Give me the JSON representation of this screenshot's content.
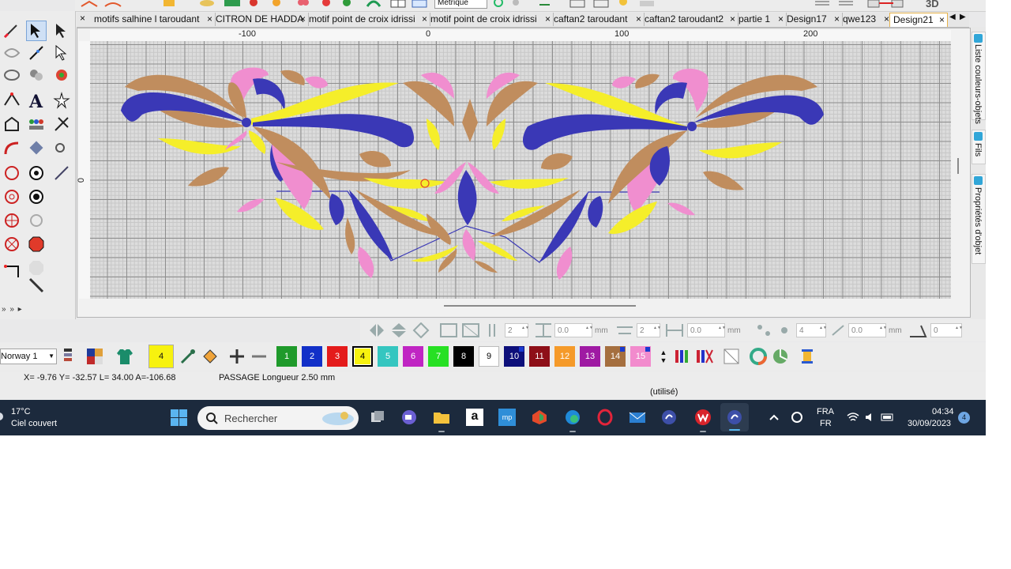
{
  "toolbar": {
    "unit_value": "Métrique",
    "top_right_text": "3D"
  },
  "tabs": [
    {
      "label": "motifs salhine l taroudant",
      "close": "×"
    },
    {
      "label": "CITRON DE HADDA",
      "close": "×"
    },
    {
      "label": "motif point de croix idrissi",
      "close": "×"
    },
    {
      "label": "motif point de croix idrissi",
      "close": "×"
    },
    {
      "label": "caftan2 taroudant",
      "close": "×"
    },
    {
      "label": "caftan2 taroudant2",
      "close": "×"
    },
    {
      "label": "partie 1",
      "close": "×"
    },
    {
      "label": "Design17",
      "close": "×"
    },
    {
      "label": "qwe123",
      "close": "×"
    },
    {
      "label": "Design21",
      "close": "×",
      "active": true
    }
  ],
  "tab_nav": {
    "close_all": "×",
    "prev": "◀",
    "next": "▶"
  },
  "right_panel": {
    "colors_objects": "Liste couleurs-objets",
    "threads": "Fils",
    "object_properties": "Propriétés d'objet"
  },
  "ruler": {
    "x_labels": [
      "-100",
      "0",
      "100",
      "200"
    ],
    "y_labels": [
      "0"
    ]
  },
  "left_panel": {
    "scroll_arrows": "» » ▸"
  },
  "properties": {
    "spin1": "2",
    "spin2": "0.0",
    "unit2": "mm",
    "spin3": "2",
    "spin4": "0.0",
    "unit4": "mm",
    "spin5": "4",
    "spin6": "0.0",
    "unit6": "mm",
    "spin7": "0"
  },
  "color_bar": {
    "profile": "Norway 1",
    "current_color": "4",
    "swatches": [
      {
        "num": "1",
        "color": "#1f9a2b",
        "text": "#ffffff"
      },
      {
        "num": "2",
        "color": "#1230c8",
        "text": "#ffffff"
      },
      {
        "num": "3",
        "color": "#e41b1b",
        "text": "#ffffff"
      },
      {
        "num": "4",
        "color": "#f7f20f",
        "text": "#000000",
        "selected": true
      },
      {
        "num": "5",
        "color": "#35c6c0",
        "text": "#ffffff"
      },
      {
        "num": "6",
        "color": "#c025c3",
        "text": "#ffffff"
      },
      {
        "num": "7",
        "color": "#27e023",
        "text": "#ffffff"
      },
      {
        "num": "8",
        "color": "#000000",
        "text": "#ffffff"
      },
      {
        "num": "9",
        "color": "#ffffff",
        "text": "#000000"
      },
      {
        "num": "10",
        "color": "#0d0f7a",
        "text": "#ffffff",
        "corner": true
      },
      {
        "num": "11",
        "color": "#8e0f18",
        "text": "#ffffff"
      },
      {
        "num": "12",
        "color": "#f59a2a",
        "text": "#ffffff"
      },
      {
        "num": "13",
        "color": "#9f1aa3",
        "text": "#ffffff"
      },
      {
        "num": "14",
        "color": "#a56f3f",
        "text": "#ffffff",
        "corner": true
      },
      {
        "num": "15",
        "color": "#f28bcd",
        "text": "#ffffff",
        "corner": true
      }
    ]
  },
  "status": {
    "coords": "X=  -9.76 Y= -32.57 L=  34.00 A=-106.68",
    "stitch": "PASSAGE Longueur   2.50 mm",
    "used": "(utilisé)"
  },
  "taskbar": {
    "temp": "17°C",
    "weather": "Ciel couvert",
    "search_placeholder": "Rechercher",
    "lang1": "FRA",
    "lang2": "FR",
    "time": "04:34",
    "date": "30/09/2023",
    "notifications": "4",
    "amazon_label": "a",
    "flow_label": "mp"
  },
  "colors": {
    "embroidery_blue": "#3a38b6",
    "embroidery_brown": "#c08d5e",
    "embroidery_yellow": "#f5ee2a",
    "embroidery_pink": "#f08ecf",
    "taskbar_bg": "#1c2a3d"
  }
}
